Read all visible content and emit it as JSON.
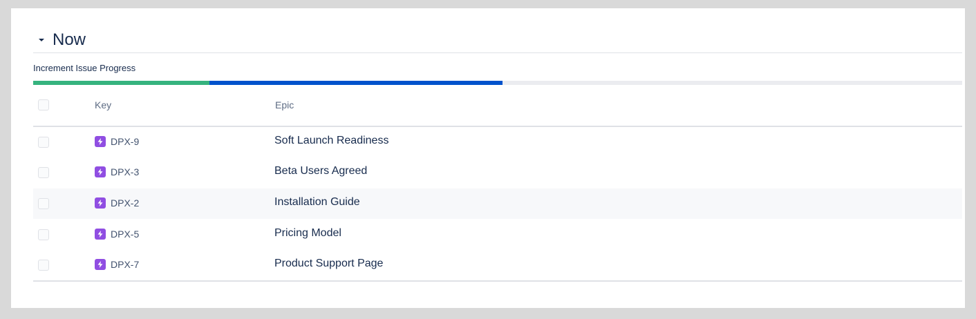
{
  "section": {
    "title": "Now",
    "collapsed": false
  },
  "progress": {
    "label": "Increment Issue Progress",
    "done_fraction": 0.19,
    "in_progress_fraction": 0.315,
    "colors": {
      "done": "#36b37e",
      "in_progress": "#0052cc",
      "todo": "#ebecf0"
    }
  },
  "table": {
    "columns": {
      "key": "Key",
      "epic": "Epic"
    },
    "rows": [
      {
        "key": "DPX-9",
        "epic": "Soft Launch Readiness",
        "icon": "epic-icon",
        "selected": false
      },
      {
        "key": "DPX-3",
        "epic": "Beta Users Agreed",
        "icon": "epic-icon",
        "selected": false
      },
      {
        "key": "DPX-2",
        "epic": "Installation Guide",
        "icon": "epic-icon",
        "selected": false
      },
      {
        "key": "DPX-5",
        "epic": "Pricing Model",
        "icon": "epic-icon",
        "selected": false
      },
      {
        "key": "DPX-7",
        "epic": "Product Support Page",
        "icon": "epic-icon",
        "selected": false
      }
    ]
  },
  "colors": {
    "epic_icon": "#904ee2"
  }
}
